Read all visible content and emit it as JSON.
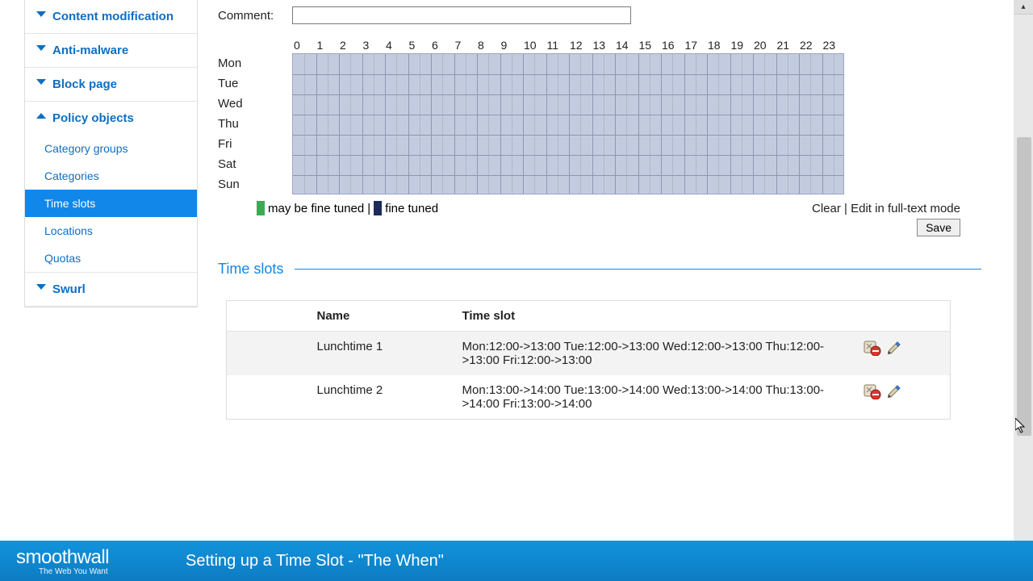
{
  "sidebar": {
    "items": [
      {
        "label": "Content modification",
        "expanded": false
      },
      {
        "label": "Anti-malware",
        "expanded": false
      },
      {
        "label": "Block page",
        "expanded": false
      },
      {
        "label": "Policy objects",
        "expanded": true,
        "children": [
          {
            "label": "Category groups"
          },
          {
            "label": "Categories"
          },
          {
            "label": "Time slots",
            "active": true
          },
          {
            "label": "Locations"
          },
          {
            "label": "Quotas"
          }
        ]
      },
      {
        "label": "Swurl",
        "expanded": false
      }
    ]
  },
  "form": {
    "comment_label": "Comment:",
    "comment_value": ""
  },
  "schedule": {
    "hours": [
      "0",
      "1",
      "2",
      "3",
      "4",
      "5",
      "6",
      "7",
      "8",
      "9",
      "10",
      "11",
      "12",
      "13",
      "14",
      "15",
      "16",
      "17",
      "18",
      "19",
      "20",
      "21",
      "22",
      "23"
    ],
    "days": [
      "Mon",
      "Tue",
      "Wed",
      "Thu",
      "Fri",
      "Sat",
      "Sun"
    ]
  },
  "legend": {
    "may_be_fine_tuned": "may be fine tuned",
    "sep": "|",
    "fine_tuned": "fine tuned",
    "clear": "Clear",
    "edit_full": "Edit in full-text mode"
  },
  "buttons": {
    "save": "Save"
  },
  "section_title": "Time slots",
  "table": {
    "headers": {
      "name": "Name",
      "slot": "Time slot"
    },
    "rows": [
      {
        "name": "Lunchtime 1",
        "slot": "Mon:12:00->13:00 Tue:12:00->13:00 Wed:12:00->13:00 Thu:12:00->13:00 Fri:12:00->13:00"
      },
      {
        "name": "Lunchtime 2",
        "slot": "Mon:13:00->14:00 Tue:13:00->14:00 Wed:13:00->14:00 Thu:13:00->14:00 Fri:13:00->14:00"
      }
    ]
  },
  "footer": {
    "brand": "smoothwall",
    "tagline": "The Web You Want",
    "title": "Setting up a Time Slot - \"The When\""
  },
  "colors": {
    "accent": "#1187ea",
    "grid_fill": "#c3ccdf"
  }
}
